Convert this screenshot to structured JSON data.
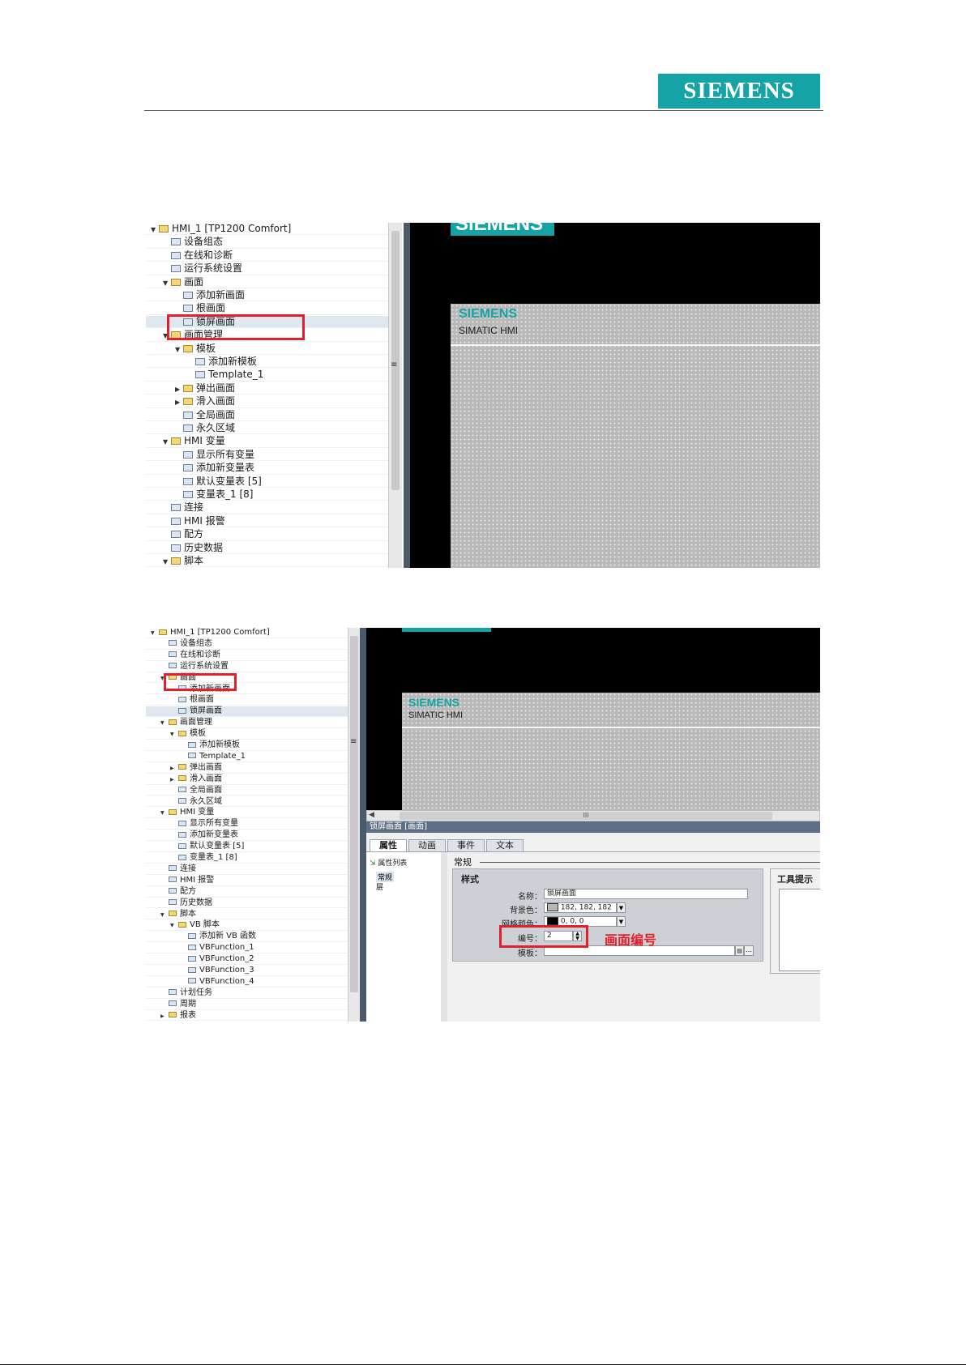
{
  "header": {
    "brand": "SIEMENS"
  },
  "shot1": {
    "tree": [
      {
        "label": "HMI_1 [TP1200 Comfort]",
        "level": 0,
        "arrow": "▼",
        "icon": "device-folder-icon"
      },
      {
        "label": "设备组态",
        "level": 1,
        "arrow": "",
        "icon": "device-config-icon"
      },
      {
        "label": "在线和诊断",
        "level": 1,
        "arrow": "",
        "icon": "diagnostics-icon"
      },
      {
        "label": "运行系统设置",
        "level": 1,
        "arrow": "",
        "icon": "runtime-settings-icon"
      },
      {
        "label": "画面",
        "level": 1,
        "arrow": "▼",
        "icon": "folder-icon"
      },
      {
        "label": "添加新画面",
        "level": 2,
        "arrow": "",
        "icon": "add-screen-icon"
      },
      {
        "label": "根画面",
        "level": 2,
        "arrow": "",
        "icon": "screen-icon"
      },
      {
        "label": "锁屏画面",
        "level": 2,
        "arrow": "",
        "icon": "screen-icon",
        "selected": true
      },
      {
        "label": "画面管理",
        "level": 1,
        "arrow": "▼",
        "icon": "folder-icon"
      },
      {
        "label": "模板",
        "level": 2,
        "arrow": "▼",
        "icon": "folder-icon"
      },
      {
        "label": "添加新模板",
        "level": 3,
        "arrow": "",
        "icon": "add-template-icon"
      },
      {
        "label": "Template_1",
        "level": 3,
        "arrow": "",
        "icon": "template-icon"
      },
      {
        "label": "弹出画面",
        "level": 2,
        "arrow": "▶",
        "icon": "folder-icon"
      },
      {
        "label": "滑入画面",
        "level": 2,
        "arrow": "▶",
        "icon": "folder-icon"
      },
      {
        "label": "全局画面",
        "level": 2,
        "arrow": "",
        "icon": "global-screen-icon"
      },
      {
        "label": "永久区域",
        "level": 2,
        "arrow": "",
        "icon": "permanent-area-icon"
      },
      {
        "label": "HMI 变量",
        "level": 1,
        "arrow": "▼",
        "icon": "folder-icon"
      },
      {
        "label": "显示所有变量",
        "level": 2,
        "arrow": "",
        "icon": "show-tags-icon"
      },
      {
        "label": "添加新变量表",
        "level": 2,
        "arrow": "",
        "icon": "add-tag-table-icon"
      },
      {
        "label": "默认变量表 [5]",
        "level": 2,
        "arrow": "",
        "icon": "tag-table-icon"
      },
      {
        "label": "变量表_1 [8]",
        "level": 2,
        "arrow": "",
        "icon": "tag-table-icon"
      },
      {
        "label": "连接",
        "level": 1,
        "arrow": "",
        "icon": "connection-icon"
      },
      {
        "label": "HMI 报警",
        "level": 1,
        "arrow": "",
        "icon": "alarm-icon"
      },
      {
        "label": "配方",
        "level": 1,
        "arrow": "",
        "icon": "recipe-icon"
      },
      {
        "label": "历史数据",
        "level": 1,
        "arrow": "",
        "icon": "history-icon"
      },
      {
        "label": "脚本",
        "level": 1,
        "arrow": "▼",
        "icon": "folder-icon"
      }
    ],
    "canvas": {
      "banner": "SIEMENS",
      "hmi_brand": "SIEMENS",
      "hmi_model": "SIMATIC HMI"
    }
  },
  "shot2": {
    "tree": [
      {
        "label": "HMI_1 [TP1200 Comfort]",
        "level": 0,
        "arrow": "▼",
        "icon": "device-folder-icon"
      },
      {
        "label": "设备组态",
        "level": 1,
        "arrow": "",
        "icon": "device-config-icon"
      },
      {
        "label": "在线和诊断",
        "level": 1,
        "arrow": "",
        "icon": "diagnostics-icon"
      },
      {
        "label": "运行系统设置",
        "level": 1,
        "arrow": "",
        "icon": "runtime-settings-icon"
      },
      {
        "label": "画面",
        "level": 1,
        "arrow": "▼",
        "icon": "folder-icon"
      },
      {
        "label": "添加新画面",
        "level": 2,
        "arrow": "",
        "icon": "add-screen-icon"
      },
      {
        "label": "根画面",
        "level": 2,
        "arrow": "",
        "icon": "screen-icon"
      },
      {
        "label": "锁屏画面",
        "level": 2,
        "arrow": "",
        "icon": "screen-icon",
        "selected": true
      },
      {
        "label": "画面管理",
        "level": 1,
        "arrow": "▼",
        "icon": "folder-icon"
      },
      {
        "label": "模板",
        "level": 2,
        "arrow": "▼",
        "icon": "folder-icon"
      },
      {
        "label": "添加新模板",
        "level": 3,
        "arrow": "",
        "icon": "add-template-icon"
      },
      {
        "label": "Template_1",
        "level": 3,
        "arrow": "",
        "icon": "template-icon"
      },
      {
        "label": "弹出画面",
        "level": 2,
        "arrow": "▶",
        "icon": "folder-icon"
      },
      {
        "label": "滑入画面",
        "level": 2,
        "arrow": "▶",
        "icon": "folder-icon"
      },
      {
        "label": "全局画面",
        "level": 2,
        "arrow": "",
        "icon": "global-screen-icon"
      },
      {
        "label": "永久区域",
        "level": 2,
        "arrow": "",
        "icon": "permanent-area-icon"
      },
      {
        "label": "HMI 变量",
        "level": 1,
        "arrow": "▼",
        "icon": "folder-icon"
      },
      {
        "label": "显示所有变量",
        "level": 2,
        "arrow": "",
        "icon": "show-tags-icon"
      },
      {
        "label": "添加新变量表",
        "level": 2,
        "arrow": "",
        "icon": "add-tag-table-icon"
      },
      {
        "label": "默认变量表 [5]",
        "level": 2,
        "arrow": "",
        "icon": "tag-table-icon"
      },
      {
        "label": "变量表_1 [8]",
        "level": 2,
        "arrow": "",
        "icon": "tag-table-icon"
      },
      {
        "label": "连接",
        "level": 1,
        "arrow": "",
        "icon": "connection-icon"
      },
      {
        "label": "HMI 报警",
        "level": 1,
        "arrow": "",
        "icon": "alarm-icon"
      },
      {
        "label": "配方",
        "level": 1,
        "arrow": "",
        "icon": "recipe-icon"
      },
      {
        "label": "历史数据",
        "level": 1,
        "arrow": "",
        "icon": "history-icon"
      },
      {
        "label": "脚本",
        "level": 1,
        "arrow": "▼",
        "icon": "folder-icon"
      },
      {
        "label": "VB 脚本",
        "level": 2,
        "arrow": "▼",
        "icon": "folder-icon"
      },
      {
        "label": "添加新 VB 函数",
        "level": 3,
        "arrow": "",
        "icon": "add-function-icon"
      },
      {
        "label": "VBFunction_1",
        "level": 3,
        "arrow": "",
        "icon": "vb-function-icon"
      },
      {
        "label": "VBFunction_2",
        "level": 3,
        "arrow": "",
        "icon": "vb-function-icon"
      },
      {
        "label": "VBFunction_3",
        "level": 3,
        "arrow": "",
        "icon": "vb-function-icon"
      },
      {
        "label": "VBFunction_4",
        "level": 3,
        "arrow": "",
        "icon": "vb-function-icon"
      },
      {
        "label": "计划任务",
        "level": 1,
        "arrow": "",
        "icon": "scheduler-icon"
      },
      {
        "label": "周期",
        "level": 1,
        "arrow": "",
        "icon": "cycle-icon"
      },
      {
        "label": "报表",
        "level": 1,
        "arrow": "▶",
        "icon": "folder-icon"
      }
    ],
    "canvas": {
      "hmi_brand": "SIEMENS",
      "hmi_model": "SIMATIC HMI",
      "scroll_grip": "III"
    },
    "properties": {
      "title": "锁屏画面 [画面]",
      "tabs": [
        "属性",
        "动画",
        "事件",
        "文本"
      ],
      "nav_header": "属性列表",
      "nav_items": [
        "常规",
        "层"
      ],
      "section_title": "常规",
      "group_title": "样式",
      "fields": {
        "name_label": "名称：",
        "name_value": "锁屏画面",
        "bg_label": "背景色：",
        "bg_value": "182, 182, 182",
        "bg_color": "#b6b6b6",
        "grid_label": "网格颜色：",
        "grid_value": "0, 0, 0",
        "grid_color": "#000000",
        "number_label": "编号：",
        "number_value": "2",
        "template_label": "模板：",
        "template_value": ""
      },
      "tooltip_title": "工具提示",
      "annotation": "画面编号"
    }
  }
}
